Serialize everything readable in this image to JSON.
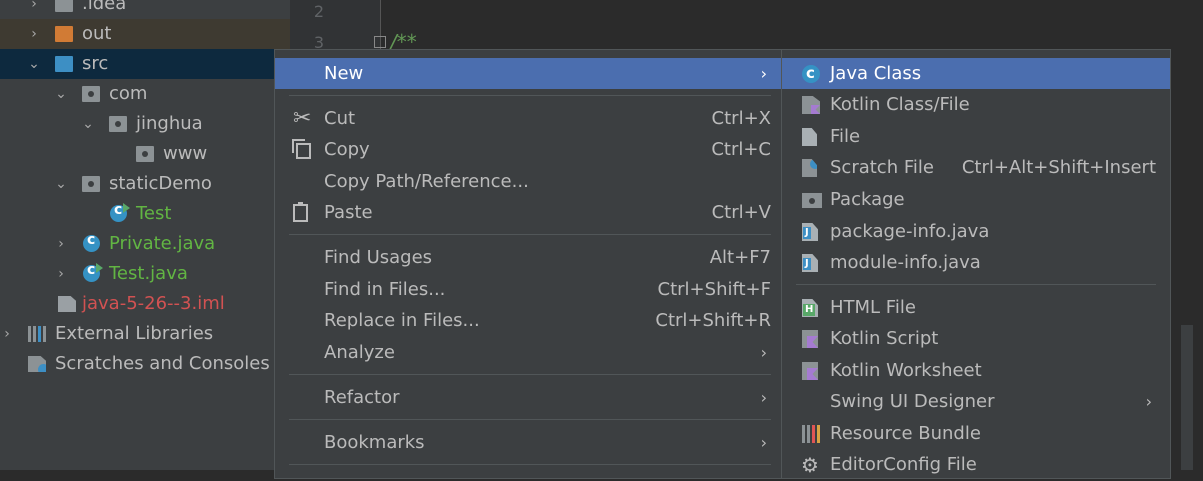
{
  "project_tree": [
    {
      "label": ".idea",
      "icon": "folder-icon",
      "arrow": "›",
      "indent": 0
    },
    {
      "label": "out",
      "icon": "folder-orange-icon",
      "arrow": "›",
      "indent": 0
    },
    {
      "label": "src",
      "icon": "folder-source-icon",
      "arrow": "⌄",
      "indent": 0
    },
    {
      "label": "com",
      "icon": "package-icon",
      "arrow": "⌄",
      "indent": 1
    },
    {
      "label": "jinghua",
      "icon": "package-icon",
      "arrow": "⌄",
      "indent": 2
    },
    {
      "label": "www",
      "icon": "package-icon",
      "arrow": "",
      "indent": 3
    },
    {
      "label": "staticDemo",
      "icon": "package-icon",
      "arrow": "⌄",
      "indent": 1
    },
    {
      "label": "Test",
      "icon": "java-class-run-icon",
      "arrow": "",
      "indent": 2
    },
    {
      "label": "Private.java",
      "icon": "java-class-icon",
      "arrow": "›",
      "indent": 1
    },
    {
      "label": "Test.java",
      "icon": "java-class-run-icon",
      "arrow": "›",
      "indent": 1
    },
    {
      "label": "java-5-26--3.iml",
      "icon": "iml-file-icon",
      "arrow": "",
      "indent": 1
    },
    {
      "label": "External Libraries",
      "icon": "library-icon",
      "arrow": "›",
      "indent": 0
    },
    {
      "label": "Scratches and Consoles",
      "icon": "scratches-icon",
      "arrow": "",
      "indent": 0
    }
  ],
  "editor": {
    "line_numbers": [
      "2",
      "3"
    ],
    "code_line": "/**"
  },
  "context_menu": {
    "new": "New",
    "cut": "Cut",
    "cut_shortcut": "Ctrl+X",
    "copy": "Copy",
    "copy_shortcut": "Ctrl+C",
    "copy_path": "Copy Path/Reference...",
    "paste": "Paste",
    "paste_shortcut": "Ctrl+V",
    "find_usages": "Find Usages",
    "find_usages_shortcut": "Alt+F7",
    "find_in_files": "Find in Files...",
    "find_in_files_shortcut": "Ctrl+Shift+F",
    "replace_in_files": "Replace in Files...",
    "replace_in_files_shortcut": "Ctrl+Shift+R",
    "analyze": "Analyze",
    "refactor": "Refactor",
    "bookmarks": "Bookmarks",
    "submenu_arrow": "›"
  },
  "new_submenu": {
    "java_class": "Java Class",
    "kotlin_class": "Kotlin Class/File",
    "file": "File",
    "scratch_file": "Scratch File",
    "scratch_shortcut": "Ctrl+Alt+Shift+Insert",
    "package": "Package",
    "package_info": "package-info.java",
    "module_info": "module-info.java",
    "html_file": "HTML File",
    "kotlin_script": "Kotlin Script",
    "kotlin_worksheet": "Kotlin Worksheet",
    "swing_ui": "Swing UI Designer",
    "resource_bundle": "Resource Bundle",
    "editorconfig": "EditorConfig File"
  },
  "colors": {
    "highlight": "#4b6eaf",
    "green_file": "#62b543",
    "red_file": "#d25252"
  }
}
